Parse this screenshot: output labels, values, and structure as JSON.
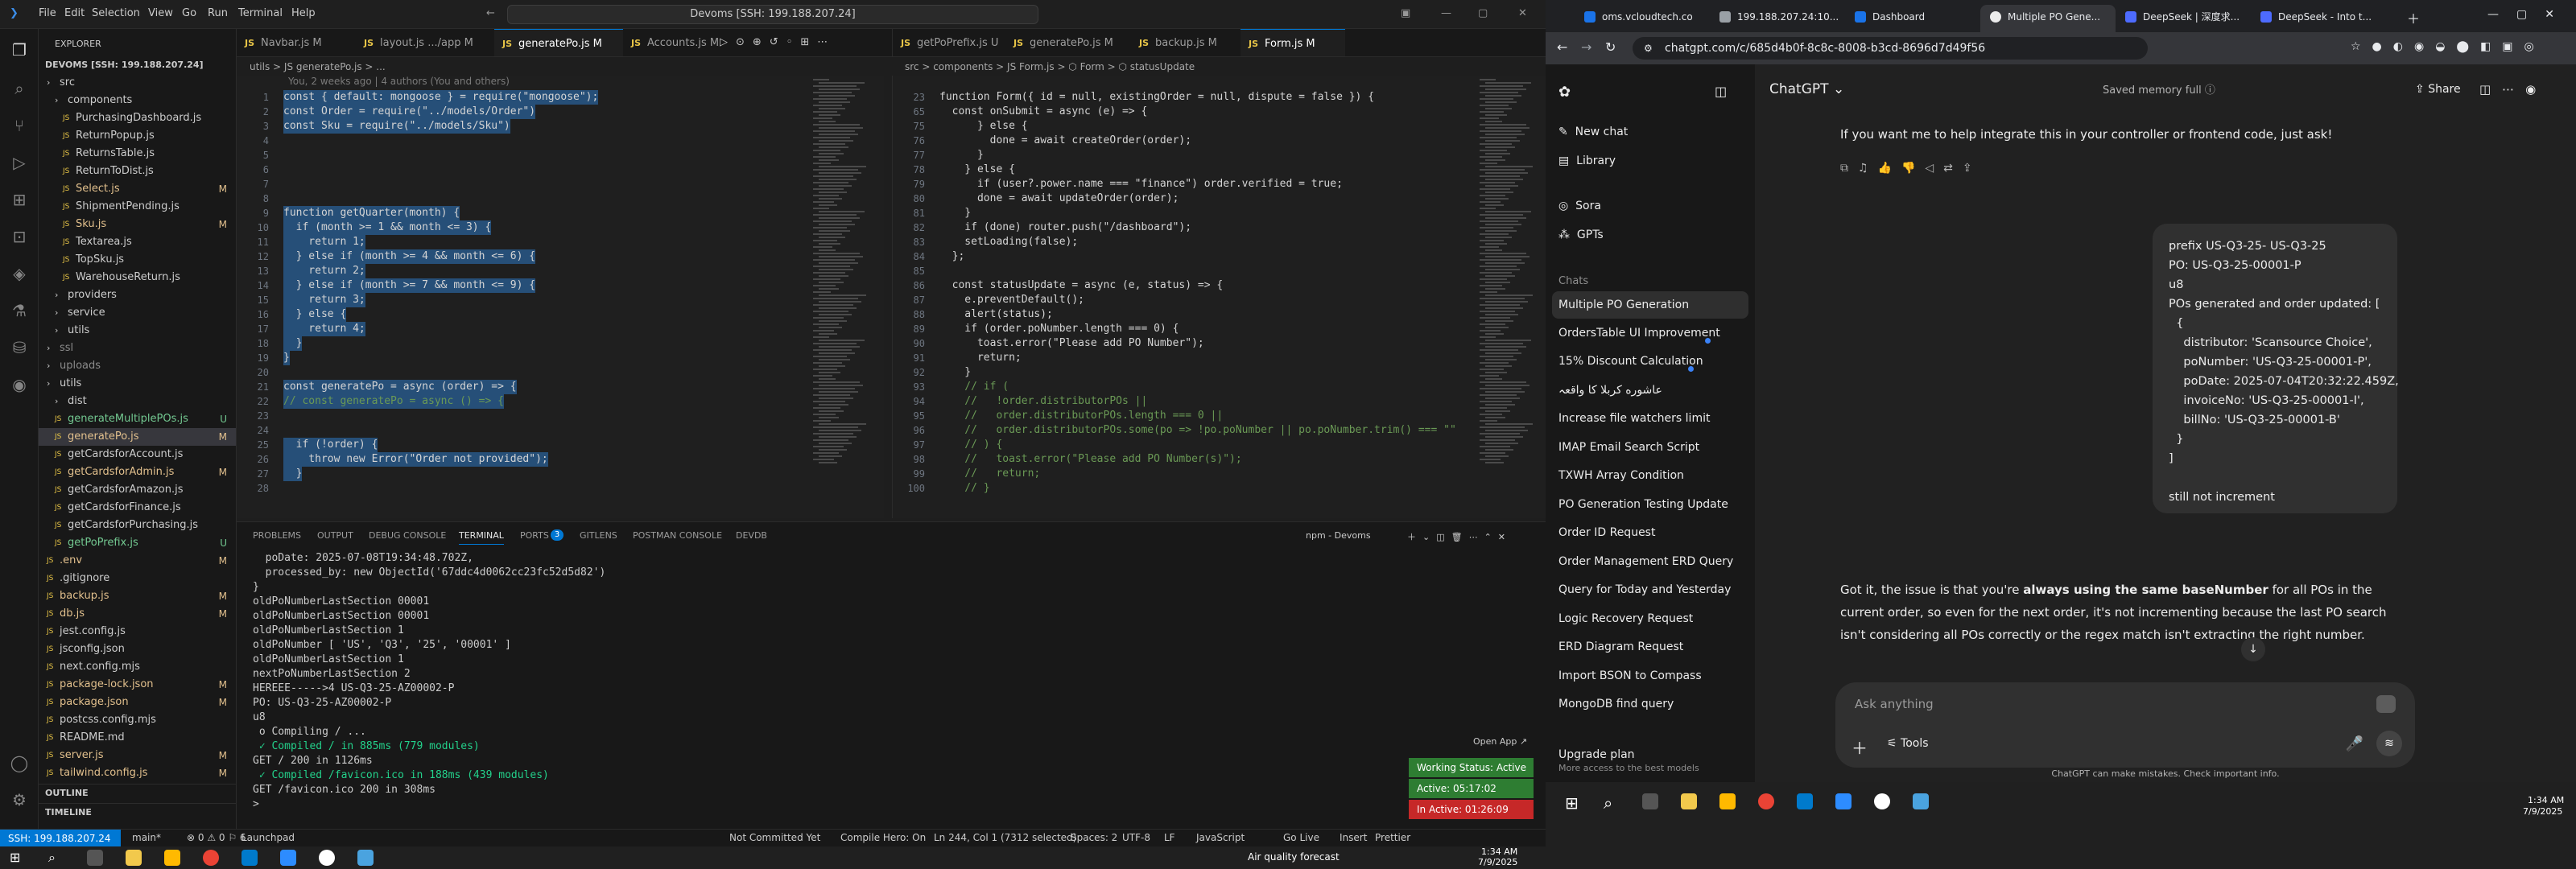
{
  "vscode": {
    "menu": [
      "File",
      "Edit",
      "Selection",
      "View",
      "Go",
      "Run",
      "Terminal",
      "Help"
    ],
    "command_center": "Devoms [SSH: 199.188.207.24]",
    "explorer": {
      "title": "EXPLORER",
      "root": "DEVOMS [SSH: 199.188.207.24]",
      "items": [
        {
          "label": "src",
          "indent": 1,
          "folder": true,
          "badge": ""
        },
        {
          "label": "components",
          "indent": 2,
          "folder": true,
          "badge": ""
        },
        {
          "label": "PurchasingDashboard.js",
          "indent": 3,
          "badge": ""
        },
        {
          "label": "ReturnPopup.js",
          "indent": 3,
          "badge": ""
        },
        {
          "label": "ReturnsTable.js",
          "indent": 3,
          "badge": ""
        },
        {
          "label": "ReturnToDist.js",
          "indent": 3,
          "badge": ""
        },
        {
          "label": "Select.js",
          "indent": 3,
          "badge": "M"
        },
        {
          "label": "ShipmentPending.js",
          "indent": 3,
          "badge": ""
        },
        {
          "label": "Sku.js",
          "indent": 3,
          "badge": "M"
        },
        {
          "label": "Textarea.js",
          "indent": 3,
          "badge": ""
        },
        {
          "label": "TopSku.js",
          "indent": 3,
          "badge": ""
        },
        {
          "label": "WarehouseReturn.js",
          "indent": 3,
          "badge": ""
        },
        {
          "label": "providers",
          "indent": 2,
          "folder": true,
          "badge": ""
        },
        {
          "label": "service",
          "indent": 2,
          "folder": true,
          "badge": ""
        },
        {
          "label": "utils",
          "indent": 2,
          "folder": true,
          "badge": ""
        },
        {
          "label": "ssl",
          "indent": 1,
          "folder": true,
          "badge": ""
        },
        {
          "label": "uploads",
          "indent": 1,
          "folder": true,
          "badge": ""
        },
        {
          "label": "utils",
          "indent": 1,
          "folder": true,
          "badge": ""
        },
        {
          "label": "dist",
          "indent": 2,
          "folder": true,
          "badge": ""
        },
        {
          "label": "generateMultiplePOs.js",
          "indent": 2,
          "badge": "U"
        },
        {
          "label": "generatePo.js",
          "indent": 2,
          "badge": "M"
        },
        {
          "label": "getCardsforAccount.js",
          "indent": 2,
          "badge": ""
        },
        {
          "label": "getCardsforAdmin.js",
          "indent": 2,
          "badge": "M"
        },
        {
          "label": "getCardsforAmazon.js",
          "indent": 2,
          "badge": ""
        },
        {
          "label": "getCardsforFinance.js",
          "indent": 2,
          "badge": ""
        },
        {
          "label": "getCardsforPurchasing.js",
          "indent": 2,
          "badge": ""
        },
        {
          "label": "getPoPrefix.js",
          "indent": 2,
          "badge": "U"
        },
        {
          "label": ".env",
          "indent": 1,
          "badge": "M"
        },
        {
          "label": ".gitignore",
          "indent": 1,
          "badge": ""
        },
        {
          "label": "backup.js",
          "indent": 1,
          "badge": "M"
        },
        {
          "label": "db.js",
          "indent": 1,
          "badge": "M"
        },
        {
          "label": "jest.config.js",
          "indent": 1,
          "badge": ""
        },
        {
          "label": "jsconfig.json",
          "indent": 1,
          "badge": ""
        },
        {
          "label": "next.config.mjs",
          "indent": 1,
          "badge": ""
        },
        {
          "label": "package-lock.json",
          "indent": 1,
          "badge": "M"
        },
        {
          "label": "package.json",
          "indent": 1,
          "badge": "M"
        },
        {
          "label": "postcss.config.mjs",
          "indent": 1,
          "badge": ""
        },
        {
          "label": "README.md",
          "indent": 1,
          "badge": ""
        },
        {
          "label": "server.js",
          "indent": 1,
          "badge": "M"
        },
        {
          "label": "tailwind.config.js",
          "indent": 1,
          "badge": "M"
        }
      ],
      "outline": "OUTLINE",
      "timeline": "TIMELINE"
    },
    "left_tabs": [
      "Navbar.js M",
      "layout.js .../app M",
      "generatePo.js M",
      "Accounts.js M"
    ],
    "right_tabs": [
      "getPoPrefix.js U",
      "generatePo.js M",
      "backup.js M",
      "Form.js M"
    ],
    "left_breadcrumb": "utils > JS generatePo.js > ...",
    "left_blame": "You, 2 weeks ago | 4 authors (You and others)",
    "right_breadcrumb": "src > components > JS Form.js > ⬡ Form > ⬡ statusUpdate",
    "left_lines": [
      "1",
      "2",
      "3",
      "4",
      "5",
      "6",
      "7",
      "8",
      "9",
      "10",
      "11",
      "12",
      "13",
      "14",
      "15",
      "16",
      "17",
      "18",
      "19",
      "20",
      "21",
      "22",
      "23",
      "24",
      "25",
      "26",
      "27",
      "28"
    ],
    "left_code": [
      "const { default: mongoose } = require(\"mongoose\");",
      "const Order = require(\"../models/Order\")",
      "const Sku = require(\"../models/Sku\")",
      "",
      "",
      "",
      "",
      "",
      "function getQuarter(month) {",
      "  if (month >= 1 && month <= 3) {",
      "    return 1;",
      "  } else if (month >= 4 && month <= 6) {",
      "    return 2;",
      "  } else if (month >= 7 && month <= 9) {",
      "    return 3;",
      "  } else {",
      "    return 4;",
      "  }",
      "}",
      "",
      "const generatePo = async (order) => {",
      "// const generatePo = async () => {",
      "",
      "",
      "  if (!order) {",
      "    throw new Error(\"Order not provided\");",
      "  }",
      ""
    ],
    "right_lines": [
      "23",
      "65",
      "75",
      "76",
      "77",
      "78",
      "79",
      "80",
      "81",
      "82",
      "83",
      "84",
      "85",
      "86",
      "87",
      "88",
      "89",
      "90",
      "91",
      "92",
      "93",
      "94",
      "95",
      "96",
      "97",
      "98",
      "99",
      "100"
    ],
    "right_code": [
      "function Form({ id = null, existingOrder = null, dispute = false }) {",
      "  const onSubmit = async (e) => {",
      "      } else {",
      "        done = await createOrder(order);",
      "      }",
      "    } else {",
      "      if (user?.power.name === \"finance\") order.verified = true;",
      "      done = await updateOrder(order);",
      "    }",
      "    if (done) router.push(\"/dashboard\");",
      "    setLoading(false);",
      "  };",
      "",
      "  const statusUpdate = async (e, status) => {",
      "    e.preventDefault();",
      "    alert(status);",
      "    if (order.poNumber.length === 0) {",
      "      toast.error(\"Please add PO Number\");",
      "      return;",
      "    }",
      "    // if (",
      "    //   !order.distributorPOs ||",
      "    //   order.distributorPOs.length === 0 ||",
      "    //   order.distributorPOs.some(po => !po.poNumber || po.poNumber.trim() === \"\"",
      "    // ) {",
      "    //   toast.error(\"Please add PO Number(s)\");",
      "    //   return;",
      "    // }"
    ],
    "panel_tabs": [
      "PROBLEMS",
      "OUTPUT",
      "DEBUG CONSOLE",
      "TERMINAL",
      "PORTS",
      "GITLENS",
      "POSTMAN CONSOLE",
      "DEVDB"
    ],
    "ports_count": "3",
    "terminal_label": "npm - Devoms",
    "terminal_lines": [
      "  poDate: 2025-07-08T19:34:48.702Z,",
      "  processed_by: new ObjectId('67ddc4d0062cc23fc52d5d82')",
      "}",
      "oldPoNumberLastSection 00001",
      "oldPoNumberLastSection 00001",
      "oldPoNumberLastSection 1",
      "oldPoNumber [ 'US', 'Q3', '25', '00001' ]",
      "oldPoNumberLastSection 1",
      "nextPoNumberLastSection 2",
      "HEREEE----->4 US-Q3-25-AZ00002-P",
      "PO: US-Q3-25-AZ00002-P",
      "u8",
      " o Compiling / ...",
      " ✓ Compiled / in 885ms (779 modules)",
      "GET / 200 in 1126ms",
      " ✓ Compiled /favicon.ico in 188ms (439 modules)",
      "GET /favicon.ico 200 in 308ms",
      ">"
    ],
    "open_app": "Open App ↗",
    "status_badges": [
      {
        "label": "Working Status: Active",
        "color": "#2e7d32"
      },
      {
        "label": "Active: 05:17:02",
        "color": "#2e7d32"
      },
      {
        "label": "In Active: 01:26:09",
        "color": "#c62828"
      }
    ],
    "statusbar": {
      "remote": "SSH: 199.188.207.24",
      "branch": "main*",
      "errors": "⊗ 0 ⚠ 0 ⚐ 6",
      "ports": "3",
      "launchpad": "Launchpad",
      "commit": "Not Committed Yet",
      "compile": "Compile Hero: On",
      "position": "Ln 244, Col 1 (7312 selected)",
      "spaces": "Spaces: 2",
      "encoding": "UTF-8",
      "eol": "LF",
      "language": "JavaScript",
      "golive": "Go Live",
      "insert": "Insert",
      "prettier": "Prettier"
    },
    "taskbar": {
      "weather": "Air quality forecast",
      "time": "1:34 AM",
      "date": "7/9/2025"
    }
  },
  "chrome": {
    "tabs": [
      "oms.vcloudtech.co",
      "199.188.207.24:10...",
      "Dashboard",
      "Multiple PO Gene...",
      "DeepSeek | 深度求...",
      "DeepSeek - Into t..."
    ],
    "active_tab": 3,
    "url": "chatgpt.com/c/685d4b0f-8c8c-8008-b3cd-8696d7d49f56",
    "sidebar": {
      "new_chat": "New chat",
      "library": "Library",
      "sora": "Sora",
      "gpts": "GPTs",
      "chats_label": "Chats",
      "chats": [
        {
          "label": "Multiple PO Generation",
          "selected": true,
          "dot": false
        },
        {
          "label": "OrdersTable UI Improvement",
          "selected": false,
          "dot": true
        },
        {
          "label": "15% Discount Calculation",
          "selected": false,
          "dot": true
        },
        {
          "label": "عاشوره کربلا کا واقعہ",
          "selected": false,
          "dot": false
        },
        {
          "label": "Increase file watchers limit",
          "selected": false,
          "dot": false
        },
        {
          "label": "IMAP Email Search Script",
          "selected": false,
          "dot": false
        },
        {
          "label": "TXWH Array Condition",
          "selected": false,
          "dot": false
        },
        {
          "label": "PO Generation Testing Update",
          "selected": false,
          "dot": false
        },
        {
          "label": "Order ID Request",
          "selected": false,
          "dot": false
        },
        {
          "label": "Order Management ERD Query",
          "selected": false,
          "dot": false
        },
        {
          "label": "Query for Today and Yesterday",
          "selected": false,
          "dot": false
        },
        {
          "label": "Logic Recovery Request",
          "selected": false,
          "dot": false
        },
        {
          "label": "ERD Diagram Request",
          "selected": false,
          "dot": false
        },
        {
          "label": "Import BSON to Compass",
          "selected": false,
          "dot": false
        },
        {
          "label": "MongoDB find query",
          "selected": false,
          "dot": false
        }
      ],
      "upgrade": "Upgrade plan",
      "upgrade_sub": "More access to the best models"
    },
    "main": {
      "model": "ChatGPT",
      "memory": "Saved memory full",
      "share": "Share",
      "assistant_top": "If you want me to help integrate this in your controller or frontend code, just ask!",
      "user_lines": [
        "prefix US-Q3-25- US-Q3-25",
        "PO: US-Q3-25-00001-P",
        "u8",
        "POs generated and order updated: [",
        "  {",
        "    distributor: 'Scansource Choice',",
        "    poNumber: 'US-Q3-25-00001-P',",
        "    poDate: 2025-07-04T20:32:22.459Z,",
        "    invoiceNo: 'US-Q3-25-00001-I',",
        "    billNo: 'US-Q3-25-00001-B'",
        "  }",
        "]",
        "",
        "still not increment"
      ],
      "answer_line1_a": "Got it, the issue is that you're ",
      "answer_line1_b": "always using the same baseNumber",
      "answer_line1_c": " for all POs in the",
      "answer_line2": "current order, so even for the next order, it's not incrementing because the last PO search",
      "answer_line3": "isn't considering all POs correctly or the regex match isn't extracting the right number.",
      "composer_placeholder": "Ask anything",
      "tools": "Tools",
      "disclaimer": "ChatGPT can make mistakes. Check important info."
    },
    "taskbar": {
      "time": "1:34 AM",
      "date": "7/9/2025"
    }
  }
}
